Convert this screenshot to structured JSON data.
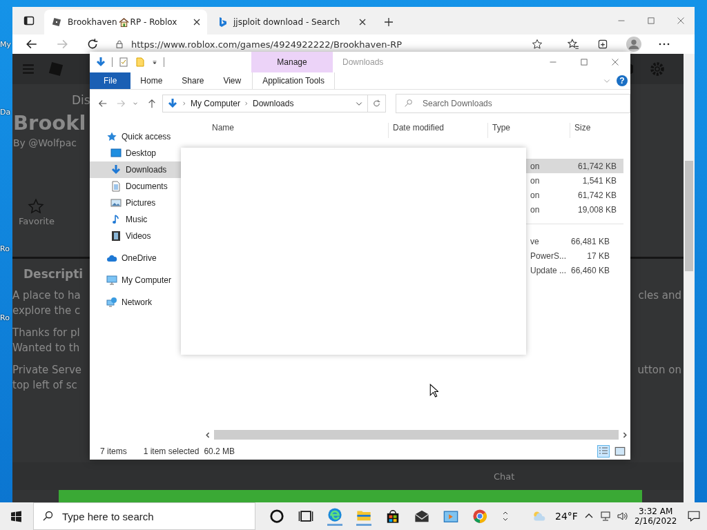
{
  "desktop": {
    "icon_labels": [
      "My",
      "Da",
      "Ro",
      "Ro"
    ]
  },
  "browser": {
    "tabs": [
      {
        "title": [
          "Brookhaven",
          "RP - Roblox"
        ],
        "kind": "roblox",
        "selected": true
      },
      {
        "title": [
          "jjsploit download - Search"
        ],
        "kind": "bing",
        "selected": false
      }
    ],
    "url": "https://www.roblox.com/games/4924922222/Brookhaven-RP",
    "page": {
      "nav_link": "Dis",
      "title": "Brookl",
      "creator": "By @Wolfpac",
      "favorite_label": "Favorite",
      "description_heading": "Descripti",
      "paragraphs": [
        [
          {
            "left": "A place to ha",
            "right": "cles and"
          },
          {
            "left": "explore the c"
          }
        ],
        [
          {
            "left": "Thanks for pl"
          },
          {
            "left": "Wanted to th"
          }
        ],
        [
          {
            "left": "Private Serve",
            "right": "utton on"
          },
          {
            "left": "top left of sc"
          }
        ]
      ],
      "chat_label": "Chat"
    }
  },
  "explorer": {
    "title": "Downloads",
    "context_tab": "Manage",
    "help_label": "?",
    "ribbon_tabs": [
      {
        "label": "File",
        "kind": "file"
      },
      {
        "label": "Home",
        "kind": "plain"
      },
      {
        "label": "Share",
        "kind": "plain"
      },
      {
        "label": "View",
        "kind": "plain"
      },
      {
        "label": "Application Tools",
        "kind": "context"
      }
    ],
    "breadcrumb": [
      "My Computer",
      "Downloads"
    ],
    "search": {
      "placeholder": "Search Downloads"
    },
    "nav": [
      {
        "label": "Quick access",
        "kind": "star",
        "children": [
          {
            "label": "Desktop",
            "kind": "desktop",
            "selected": false
          },
          {
            "label": "Downloads",
            "kind": "download",
            "selected": true
          },
          {
            "label": "Documents",
            "kind": "document",
            "selected": false
          },
          {
            "label": "Pictures",
            "kind": "picture",
            "selected": false
          },
          {
            "label": "Music",
            "kind": "music",
            "selected": false
          },
          {
            "label": "Videos",
            "kind": "video",
            "selected": false
          }
        ]
      },
      {
        "label": "OneDrive",
        "kind": "cloud"
      },
      {
        "label": "My Computer",
        "kind": "computer"
      },
      {
        "label": "Network",
        "kind": "network"
      }
    ],
    "columns": [
      "Name",
      "Date modified",
      "Type",
      "Size"
    ],
    "groups": [
      {
        "rows": [
          {
            "type": "on",
            "size": "61,742 KB",
            "selected": true
          },
          {
            "type": "on",
            "size": "1,541 KB",
            "selected": false
          },
          {
            "type": "on",
            "size": "61,742 KB",
            "selected": false
          },
          {
            "type": "on",
            "size": "19,008 KB",
            "selected": false
          }
        ]
      },
      {
        "rows": [
          {
            "type": "ve",
            "size": "66,481 KB",
            "selected": false
          },
          {
            "type": "PowerS...",
            "size": "17 KB",
            "selected": false
          },
          {
            "type": "Update ...",
            "size": "66,460 KB",
            "selected": false
          }
        ]
      }
    ],
    "status": {
      "count": "7 items",
      "selection": "1 item selected",
      "size": "60.2 MB"
    }
  },
  "taskbar": {
    "search_placeholder": "Type here to search",
    "temperature": "24°F",
    "time": "3:32 AM",
    "date": "2/16/2022"
  }
}
